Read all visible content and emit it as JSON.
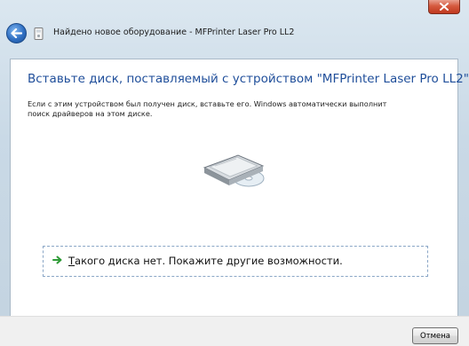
{
  "window": {
    "title": "Найдено новое оборудование - MFPrinter Laser Pro LL2"
  },
  "content": {
    "heading": "Вставьте диск, поставляемый с устройством \"MFPrinter Laser Pro LL2\"",
    "description": "Если с этим устройством был получен диск, вставьте его.  Windows автоматически выполнит поиск драйверов на этом диске.",
    "option": {
      "first_letter": "Т",
      "label_rest": "акого диска нет. Покажите другие возможности."
    }
  },
  "footer": {
    "cancel_label": "Отмена"
  },
  "icons": {
    "close": "close-icon",
    "back": "back-arrow-icon",
    "device": "device-icon",
    "scanner": "scanner-cd-icon",
    "option_arrow": "green-arrow-icon"
  },
  "colors": {
    "heading": "#1f4e9a",
    "close_button": "#c0391f",
    "option_arrow": "#2e9b36"
  }
}
